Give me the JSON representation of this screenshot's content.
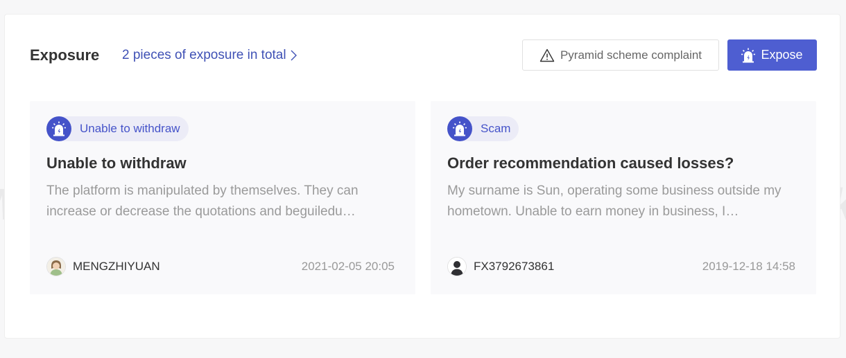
{
  "header": {
    "title": "Exposure",
    "total_link": "2 pieces of exposure in total"
  },
  "actions": {
    "complaint_label": "Pyramid scheme complaint",
    "expose_label": "Expose"
  },
  "cards": [
    {
      "tag": "Unable to withdraw",
      "title": "Unable to withdraw",
      "description": "The platform is manipulated by themselves. They can increase or decrease the quotations and beguiledu…",
      "author": "MENGZHIYUAN",
      "time": "2021-02-05 20:05",
      "avatar": "user-photo-avatar"
    },
    {
      "tag": "Scam",
      "title": "Order recommendation caused losses?",
      "description": "My surname is Sun, operating some business outside my hometown. Unable to earn money in business, I…",
      "author": "FX3792673861",
      "time": "2019-12-18 14:58",
      "avatar": "default-user-avatar"
    }
  ],
  "watermark": "WikiFX",
  "colors": {
    "accent": "#4553c9",
    "button": "#4e5ed1",
    "link": "#3f51b5"
  }
}
